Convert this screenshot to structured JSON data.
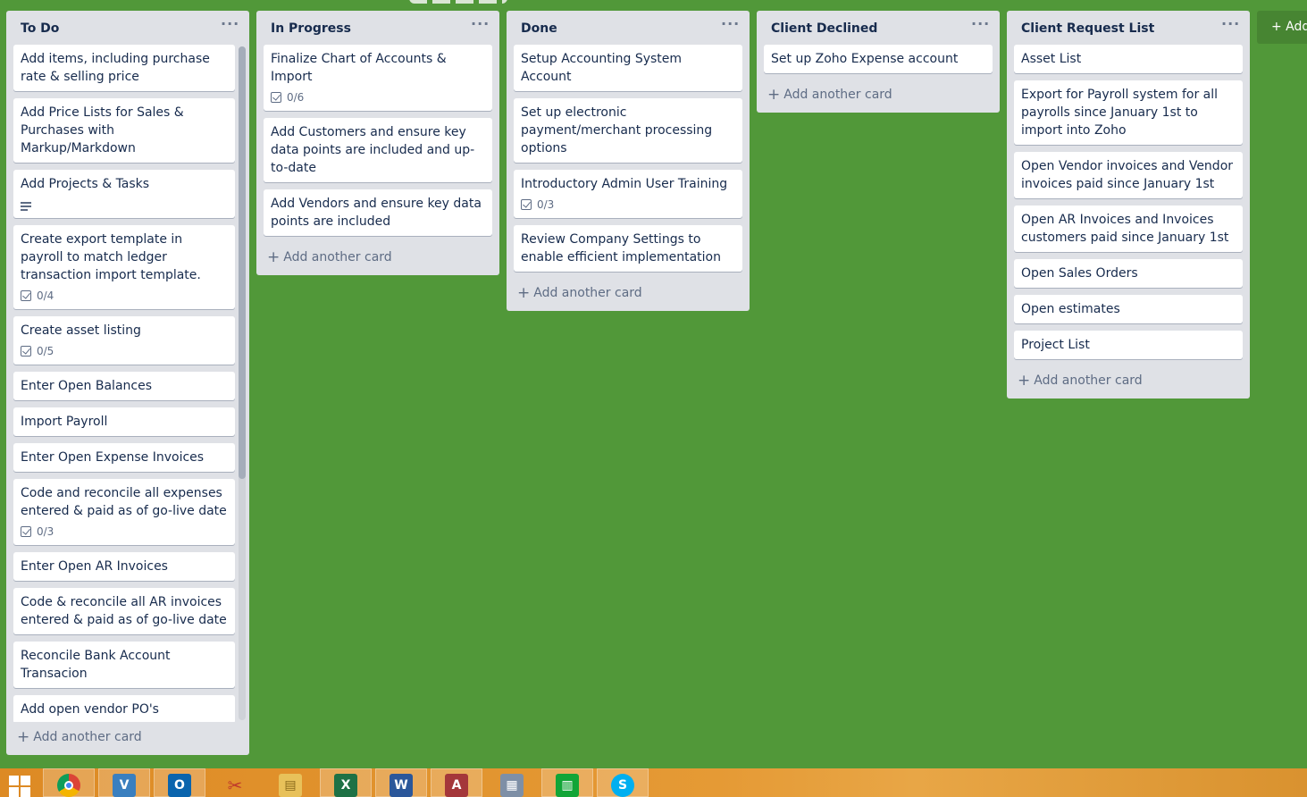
{
  "board": {
    "lists": [
      {
        "title": "To Do",
        "cards": [
          {
            "title": "Add items, including purchase rate & selling price"
          },
          {
            "title": "Add Price Lists for Sales & Purchases with Markup/Markdown"
          },
          {
            "title": "Add Projects & Tasks",
            "description_icon": "description-icon"
          },
          {
            "title": "Create export template in payroll to match ledger transaction import template.",
            "checklist": "0/4"
          },
          {
            "title": "Create asset listing",
            "checklist": "0/5"
          },
          {
            "title": "Enter Open Balances"
          },
          {
            "title": "Import Payroll"
          },
          {
            "title": "Enter Open Expense Invoices"
          },
          {
            "title": "Code and reconcile all expenses entered & paid as of go-live date",
            "checklist": "0/3"
          },
          {
            "title": "Enter Open AR Invoices"
          },
          {
            "title": "Code & reconcile all AR invoices entered & paid as of go-live date"
          },
          {
            "title": "Reconcile Bank Account Transacion"
          },
          {
            "title": "Add open vendor PO's"
          },
          {
            "title": ""
          }
        ],
        "add_card_label": "Add another card"
      },
      {
        "title": "In Progress",
        "cards": [
          {
            "title": "Finalize Chart of Accounts & Import",
            "checklist": "0/6"
          },
          {
            "title": "Add Customers and ensure key data points are included and up-to-date"
          },
          {
            "title": "Add Vendors and ensure key data points are included"
          }
        ],
        "add_card_label": "Add another card"
      },
      {
        "title": "Done",
        "cards": [
          {
            "title": "Setup Accounting System Account"
          },
          {
            "title": "Set up electronic payment/merchant processing options"
          },
          {
            "title": "Introductory Admin User Training",
            "checklist": "0/3"
          },
          {
            "title": "Review Company Settings to enable efficient implementation"
          }
        ],
        "add_card_label": "Add another card"
      },
      {
        "title": "Client Declined",
        "cards": [
          {
            "title": "Set up Zoho Expense account"
          }
        ],
        "add_card_label": "Add another card"
      },
      {
        "title": "Client Request List",
        "cards": [
          {
            "title": "Asset List"
          },
          {
            "title": "Export for Payroll system for all payrolls since January 1st to import into Zoho"
          },
          {
            "title": "Open Vendor invoices and Vendor invoices paid since January 1st"
          },
          {
            "title": "Open AR Invoices and Invoices customers paid since January 1st"
          },
          {
            "title": "Open Sales Orders"
          },
          {
            "title": "Open estimates"
          },
          {
            "title": "Project List"
          }
        ],
        "add_card_label": "Add another card"
      }
    ],
    "list_menu_glyph": "···",
    "add_list_label": "+ Add"
  },
  "taskbar": {
    "apps": [
      {
        "name": "windows-start-icon",
        "glyph": ""
      },
      {
        "name": "chrome-icon",
        "glyph": "",
        "color": "#db4437",
        "active": true
      },
      {
        "name": "visio-icon",
        "glyph": "V",
        "color": "#3a7fbf",
        "active": true
      },
      {
        "name": "outlook-icon",
        "glyph": "O",
        "color": "#0a64ad",
        "active": true
      },
      {
        "name": "snipping-tool-icon",
        "glyph": "✂",
        "color": "#c0392b"
      },
      {
        "name": "file-explorer-icon",
        "glyph": "▤",
        "color": "#e8c15a"
      },
      {
        "name": "excel-icon",
        "glyph": "X",
        "color": "#1e7145",
        "active": true
      },
      {
        "name": "word-icon",
        "glyph": "W",
        "color": "#2b579a",
        "active": true
      },
      {
        "name": "access-icon",
        "glyph": "A",
        "color": "#a4373a",
        "active": true
      },
      {
        "name": "calculator-icon",
        "glyph": "▦",
        "color": "#7e8fa6"
      },
      {
        "name": "building-app-icon",
        "glyph": "▥",
        "color": "#12a537",
        "active": true
      },
      {
        "name": "skype-icon",
        "glyph": "S",
        "color": "#00aff0",
        "active": true
      }
    ]
  }
}
